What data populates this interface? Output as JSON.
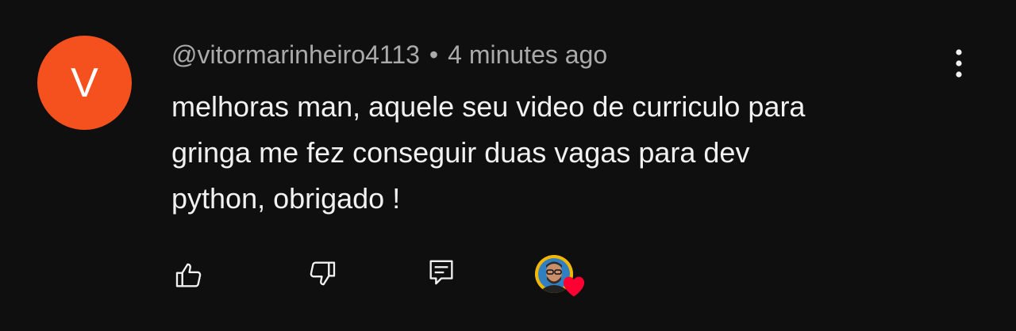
{
  "comment": {
    "avatar_letter": "V",
    "avatar_color": "#f4511e",
    "author": "@vitormarinheiro4113",
    "separator": "•",
    "time": "4 minutes ago",
    "text": "melhoras man, aquele seu video de curriculo para\ngringa me fez conseguir duas vagas para dev\npython, obrigado !"
  },
  "actions": {
    "like_icon": "thumbs-up-icon",
    "dislike_icon": "thumbs-down-icon",
    "reply_icon": "reply-comment-icon",
    "menu_icon": "more-vertical-icon"
  },
  "hearted": {
    "heart_color": "#ff0033",
    "creator_avatar_color": "#f2b705"
  }
}
